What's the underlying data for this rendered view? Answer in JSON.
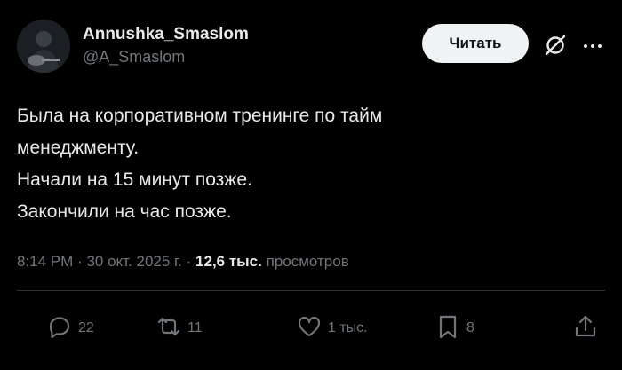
{
  "author": {
    "display_name": "Annushka_Smaslom",
    "handle": "@A_Smaslom"
  },
  "follow_button": "Читать",
  "icons": {
    "grok": "grok-slash-circle-icon",
    "more": "more-horizontal-icon",
    "reply": "reply-icon",
    "retweet": "retweet-icon",
    "like": "heart-icon",
    "bookmark": "bookmark-icon",
    "share": "share-icon"
  },
  "tweet": {
    "lines": [
      "Была на корпоративном тренинге по тайм",
      "менеджменту.",
      "Начали на 15 минут позже.",
      "Закончили на час позже."
    ]
  },
  "meta": {
    "time": "8:14 PM",
    "date": "30 окт. 2025 г.",
    "views": "12,6 тыс.",
    "views_label": "просмотров"
  },
  "stats": {
    "replies": "22",
    "retweets": "11",
    "likes": "1 тыс.",
    "bookmarks": "8"
  },
  "colors": {
    "background": "#000000",
    "text": "#e7e9ea",
    "secondary": "#71767b",
    "button_bg": "#eff3f4",
    "divider": "#2f3336"
  }
}
